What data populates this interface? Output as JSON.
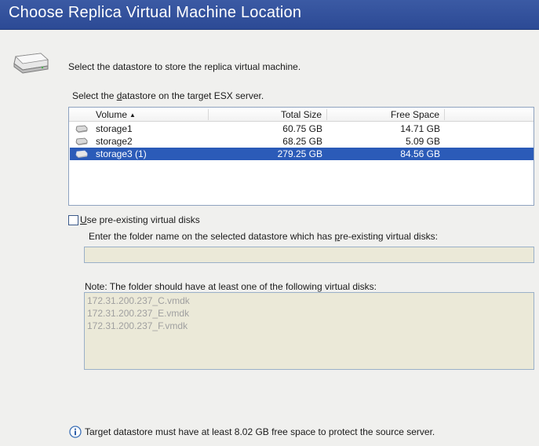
{
  "header": {
    "title": "Choose Replica Virtual Machine Location"
  },
  "intro": "Select the datastore to store the replica virtual machine.",
  "datastore_label": {
    "pre": "Select the ",
    "accel": "d",
    "post": "atastore on the target ESX server."
  },
  "grid": {
    "columns": {
      "volume": "Volume",
      "total_size": "Total Size",
      "free_space": "Free Space"
    },
    "sort_indicator": "▲",
    "rows": [
      {
        "volume": "storage1",
        "total_size": "60.75 GB",
        "free_space": "14.71 GB",
        "selected": false
      },
      {
        "volume": "storage2",
        "total_size": "68.25 GB",
        "free_space": "5.09 GB",
        "selected": false
      },
      {
        "volume": "storage3 (1)",
        "total_size": "279.25 GB",
        "free_space": "84.56 GB",
        "selected": true
      }
    ]
  },
  "use_existing": {
    "accel": "U",
    "rest": "se pre-existing virtual disks",
    "checked": false
  },
  "folder_label": {
    "pre": "Enter the folder name on the selected datastore which has ",
    "accel": "p",
    "post": "re-existing virtual disks:"
  },
  "folder_value": "",
  "note_label": "Note: The folder should have at least one of the following virtual disks:",
  "virtual_disks": [
    "172.31.200.237_C.vmdk",
    "172.31.200.237_E.vmdk",
    "172.31.200.237_F.vmdk"
  ],
  "footer": "Target datastore must have at least 8.02 GB free space to protect the source server.",
  "colors": {
    "header_bg": "#2f4e9a",
    "selection_bg": "#2b5bb8",
    "readonly_bg": "#ebe9d8"
  }
}
